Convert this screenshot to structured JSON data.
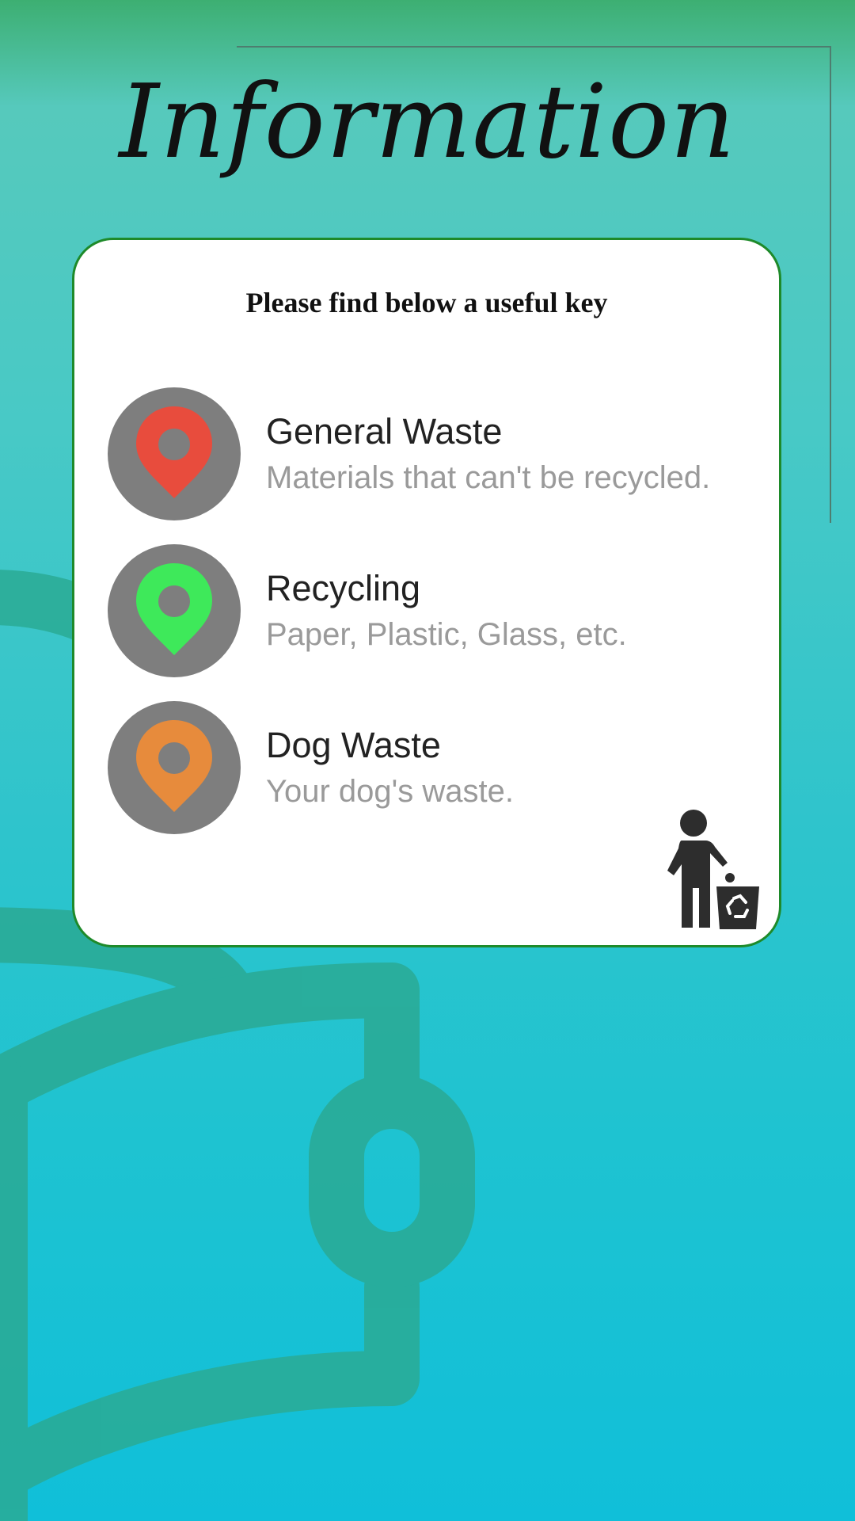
{
  "page": {
    "title": "Information"
  },
  "card": {
    "heading": "Please find below a useful key",
    "items": [
      {
        "title": "General Waste",
        "description": "Materials that can't be recycled.",
        "icon": "location-pin-icon",
        "pin_color": "#e84c3d"
      },
      {
        "title": "Recycling",
        "description": "Paper, Plastic, Glass, etc.",
        "icon": "location-pin-icon",
        "pin_color": "#3ee95a"
      },
      {
        "title": "Dog Waste",
        "description": "Your dog's waste.",
        "icon": "location-pin-icon",
        "pin_color": "#e78b3c"
      }
    ],
    "illustration": "person-recycling-icon"
  },
  "colors": {
    "card_border": "#1e8a2a",
    "icon_circle": "#7e7e7e",
    "title_text": "#222222",
    "description_text": "#9a9a9a"
  }
}
